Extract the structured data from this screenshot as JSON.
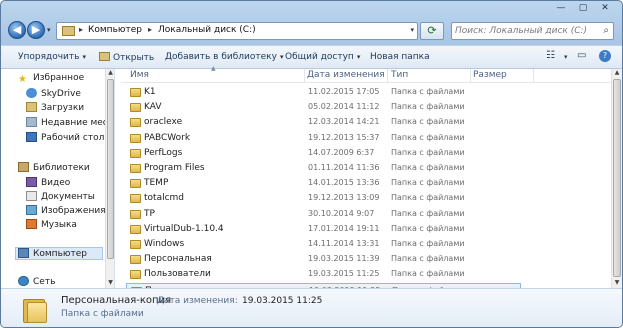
{
  "window": {
    "controls": [
      "—",
      "▢",
      "✕"
    ]
  },
  "address_bar": {
    "crumbs": [
      "Компьютер",
      "Локальный диск (C:)"
    ],
    "separator": "▸"
  },
  "search": {
    "placeholder": "Поиск: Локальный диск (C:)"
  },
  "toolbar": {
    "organize": "Упорядочить",
    "open": "Открыть",
    "add_to_library": "Добавить в библиотеку",
    "share": "Общий доступ",
    "new_folder": "Новая папка",
    "caret": "▾"
  },
  "nav": {
    "favorites": "Избранное",
    "skydrive": "SkyDrive",
    "downloads": "Загрузки",
    "recent": "Недавние места",
    "desktop": "Рабочий стол",
    "libraries": "Библиотеки",
    "video": "Видео",
    "documents": "Документы",
    "images": "Изображения",
    "music": "Музыка",
    "computer": "Компьютер",
    "network": "Сеть"
  },
  "columns": {
    "name": "Имя",
    "date": "Дата изменения",
    "type": "Тип",
    "size": "Размер"
  },
  "files": [
    {
      "name": "K1",
      "date": "11.02.2015 17:05",
      "type": "Папка с файлами"
    },
    {
      "name": "KAV",
      "date": "05.02.2014 11:12",
      "type": "Папка с файлами"
    },
    {
      "name": "oraclexe",
      "date": "12.03.2014 14:21",
      "type": "Папка с файлами"
    },
    {
      "name": "PABCWork",
      "date": "19.12.2013 15:37",
      "type": "Папка с файлами"
    },
    {
      "name": "PerfLogs",
      "date": "14.07.2009 6:37",
      "type": "Папка с файлами"
    },
    {
      "name": "Program Files",
      "date": "01.11.2014 11:36",
      "type": "Папка с файлами"
    },
    {
      "name": "TEMP",
      "date": "14.01.2015 13:36",
      "type": "Папка с файлами"
    },
    {
      "name": "totalcmd",
      "date": "19.12.2013 13:09",
      "type": "Папка с файлами"
    },
    {
      "name": "TP",
      "date": "30.10.2014 9:07",
      "type": "Папка с файлами"
    },
    {
      "name": "VirtualDub-1.10.4",
      "date": "17.01.2014 19:11",
      "type": "Папка с файлами"
    },
    {
      "name": "Windows",
      "date": "14.11.2014 13:31",
      "type": "Папка с файлами"
    },
    {
      "name": "Персональная",
      "date": "19.03.2015 11:39",
      "type": "Папка с файлами"
    },
    {
      "name": "Пользователи",
      "date": "19.03.2015 11:25",
      "type": "Папка с файлами"
    },
    {
      "name": "Персональная-копия",
      "date": "19.03.2015 11:25",
      "type": "Папка с файлами"
    }
  ],
  "selected_index": 13,
  "details": {
    "name": "Персональная-копия",
    "date_label": "Дата изменения:",
    "date": "19.03.2015 11:25",
    "type": "Папка с файлами"
  }
}
